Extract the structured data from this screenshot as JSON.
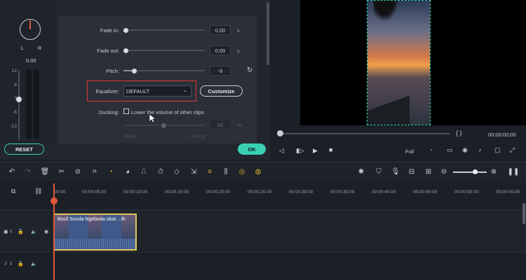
{
  "audio": {
    "pan": {
      "left": "L",
      "right": "R",
      "value": "0,00"
    },
    "meter_scale": [
      "12",
      "6",
      "0",
      "-6",
      "-12"
    ],
    "fade_in": {
      "label": "Fade in:",
      "value": "0,00",
      "unit": "s",
      "level": 0
    },
    "fade_out": {
      "label": "Fade out:",
      "value": "0,00",
      "unit": "s",
      "level": 0
    },
    "pitch": {
      "label": "Pitch:",
      "value": "-9",
      "level": 0.13
    },
    "equalizer": {
      "label": "Equalizer:",
      "value": "DEFAULT",
      "customize": "Customize"
    },
    "ducking": {
      "label": "Ducking:",
      "checkbox_label": "Lower the volume of other clips",
      "value": "50",
      "unit": "%",
      "level": 0.5,
      "faint_left": "Weak",
      "faint_right": "Strong"
    },
    "reset": "RESET",
    "ok": "OK"
  },
  "preview": {
    "brackets": "{   }",
    "timecode": "00:00:00:00",
    "quality": "Full",
    "progress": 0
  },
  "timeline": {
    "ruler": [
      "00:00",
      "00:00:05:00",
      "00:00:10:00",
      "00:00:15:00",
      "00:00:20:00",
      "00:00:25:00",
      "00:00:30:00",
      "00:00:35:00",
      "00:00:40:00",
      "00:00:45:00",
      "00:00:50:00",
      "00:00:55:00"
    ],
    "clip_title": "Bocil Sunda Ngeboda obat ...th",
    "video_track_num": "1",
    "audio_track_num": "1"
  },
  "colors": {
    "accent": "#3ad1b3",
    "highlight": "#e03a3a",
    "clip_border": "#e3c35a",
    "playhead": "#e05a3a"
  }
}
